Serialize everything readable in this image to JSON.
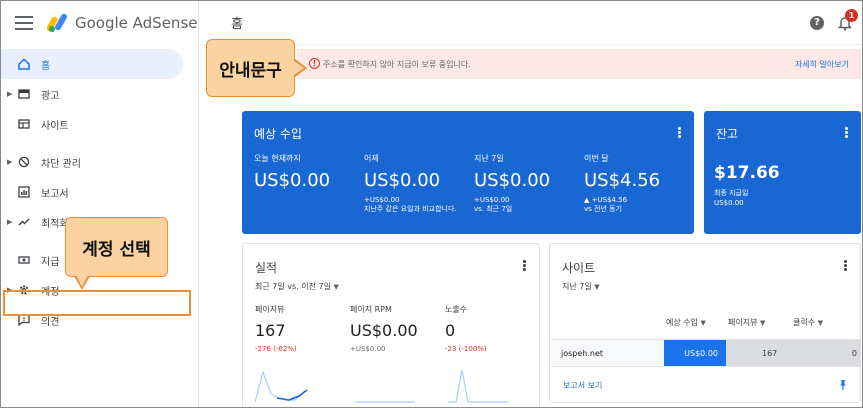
{
  "app": {
    "logo_text": "Google AdSense",
    "page_title": "홈",
    "notification_count": "1"
  },
  "sidebar": {
    "items": [
      {
        "label": "홈",
        "icon": "home-icon"
      },
      {
        "label": "광고",
        "icon": "ads-icon"
      },
      {
        "label": "사이트",
        "icon": "sites-icon"
      },
      {
        "label": "차단 관리",
        "icon": "block-icon"
      },
      {
        "label": "보고서",
        "icon": "report-icon"
      },
      {
        "label": "최적화",
        "icon": "optimize-icon"
      },
      {
        "label": "지급",
        "icon": "payments-icon"
      },
      {
        "label": "계정",
        "icon": "gear-icon"
      },
      {
        "label": "의견",
        "icon": "feedback-icon"
      }
    ]
  },
  "alert": {
    "message": "주소를 확인하지 않아 지급이 보류 중입니다.",
    "link": "자세히 알아보기"
  },
  "callouts": {
    "notice": "안내문구",
    "account": "계정 선택"
  },
  "earnings": {
    "title": "예상 수입",
    "metrics": [
      {
        "label": "오늘 현재까지",
        "value": "US$0.00",
        "sub": ""
      },
      {
        "label": "어제",
        "value": "US$0.00",
        "sub": "+US$0.00\n지난주 같은 요일과 비교합니다."
      },
      {
        "label": "지난 7일",
        "value": "US$0.00",
        "sub": "+US$0.00\nvs. 최근 7일"
      },
      {
        "label": "이번 달",
        "value": "US$4.56",
        "sub": "▲ +US$4.56\nvs 전년 동기"
      }
    ]
  },
  "balance": {
    "title": "잔고",
    "value": "$17.66",
    "sub": "최종 지급일\nUS$0.00"
  },
  "performance": {
    "title": "실적",
    "range": "최근 7일 vs. 이전 7일",
    "metrics": [
      {
        "label": "페이지뷰",
        "value": "167",
        "sub": "-276 (-62%)"
      },
      {
        "label": "페이지 RPM",
        "value": "US$0.00",
        "sub": "+US$0.00"
      },
      {
        "label": "노출수",
        "value": "0",
        "sub": "-23 (-100%)"
      }
    ]
  },
  "sites": {
    "title": "사이트",
    "range": "지난 7일",
    "columns": [
      "예상 수입",
      "페이지뷰",
      "클릭수"
    ],
    "rows": [
      {
        "site": "jospeh.net",
        "earnings": "US$0.00",
        "pageviews": "167",
        "clicks": "0"
      }
    ],
    "report_link": "보고서 보기"
  },
  "colors": {
    "primary": "#1967d2",
    "accent": "#1a73e8",
    "alert_bg": "#fce8e6",
    "callout": "#fbd3a0"
  }
}
